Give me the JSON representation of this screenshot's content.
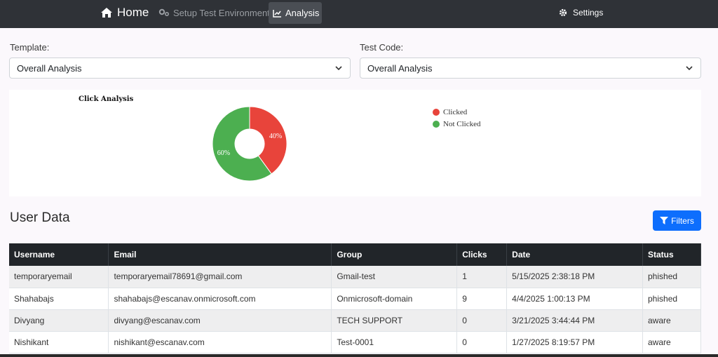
{
  "nav": {
    "home": "Home",
    "setup": "Setup Test Environment",
    "analysis": "Analysis",
    "settings": "Settings"
  },
  "filters": {
    "template_label": "Template:",
    "template_value": "Overall Analysis",
    "testcode_label": "Test Code:",
    "testcode_value": "Overall Analysis"
  },
  "chart_data": {
    "type": "pie",
    "title": "Click Analysis",
    "categories": [
      "Clicked",
      "Not Clicked"
    ],
    "values": [
      40,
      60
    ],
    "labels": [
      "40%",
      "60%"
    ],
    "colors": [
      "#e8443b",
      "#4caf50"
    ],
    "donut": true,
    "legend": "right"
  },
  "user_data": {
    "title": "User Data",
    "filters_button": "Filters",
    "columns": [
      "Username",
      "Email",
      "Group",
      "Clicks",
      "Date",
      "Status"
    ],
    "rows": [
      [
        "temporaryemail",
        "temporaryemail78691@gmail.com",
        "Gmail-test",
        "1",
        "5/15/2025 2:38:18 PM",
        "phished"
      ],
      [
        "Shahabajs",
        "shahabajs@escanav.onmicrosoft.com",
        "Onmicrosoft-domain",
        "9",
        "4/4/2025 1:00:13 PM",
        "phished"
      ],
      [
        "Divyang",
        "divyang@escanav.com",
        "TECH SUPPORT",
        "0",
        "3/21/2025 3:44:44 PM",
        "aware"
      ],
      [
        "Nishikant",
        "nishikant@escanav.com",
        "Test-0001",
        "0",
        "1/27/2025 8:19:57 PM",
        "aware"
      ]
    ]
  }
}
